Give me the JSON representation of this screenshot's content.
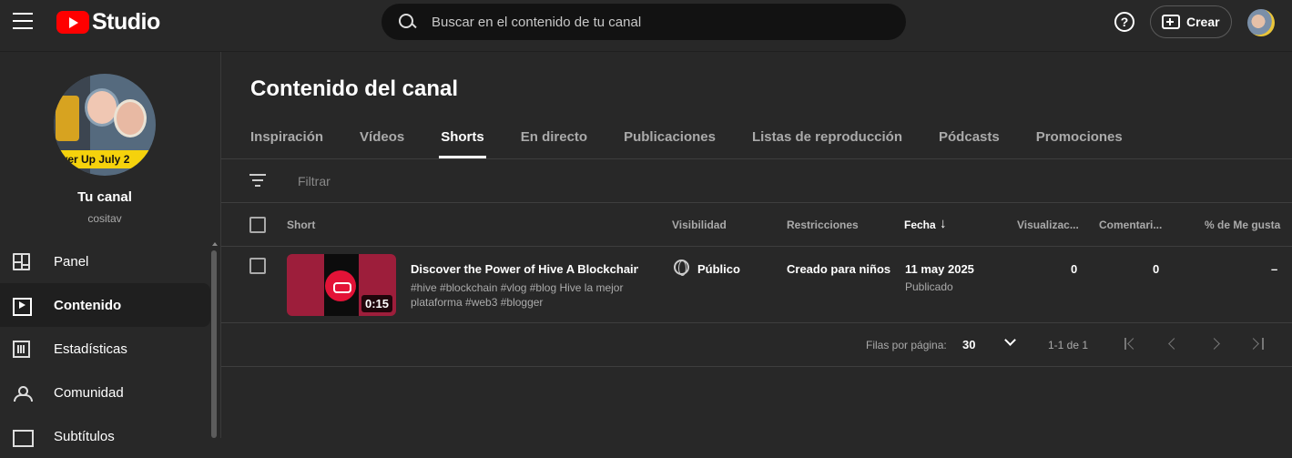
{
  "header": {
    "logo_text": "Studio",
    "search_placeholder": "Buscar en el contenido de tu canal",
    "help_label": "?",
    "create_label": "Crear"
  },
  "sidebar": {
    "avatar_banner_text": "wer Up July 2",
    "channel_label": "Tu canal",
    "handle": "cositav",
    "items": [
      {
        "label": "Panel",
        "icon": "dashboard-icon"
      },
      {
        "label": "Contenido",
        "icon": "content-icon"
      },
      {
        "label": "Estadísticas",
        "icon": "analytics-icon"
      },
      {
        "label": "Comunidad",
        "icon": "community-icon"
      },
      {
        "label": "Subtítulos",
        "icon": "subtitles-icon"
      }
    ]
  },
  "main": {
    "title": "Contenido del canal",
    "tabs": [
      "Inspiración",
      "Vídeos",
      "Shorts",
      "En directo",
      "Publicaciones",
      "Listas de reproducción",
      "Pódcasts",
      "Promociones"
    ],
    "active_tab": "Shorts",
    "filter_placeholder": "Filtrar",
    "columns": {
      "short": "Short",
      "visibility": "Visibilidad",
      "restrictions": "Restricciones",
      "date": "Fecha",
      "views": "Visualizac...",
      "comments": "Comentari...",
      "likes": "% de Me gusta"
    },
    "rows": [
      {
        "duration": "0:15",
        "title": "Discover the Power of Hive A Blockchain ...",
        "description": "#hive #blockchain #vlog #blog Hive la mejor plataforma #web3 #blogger",
        "visibility": "Público",
        "restrictions": "Creado para niños",
        "date": "11 may 2025",
        "status": "Publicado",
        "views": "0",
        "comments": "0",
        "likes": "–"
      }
    ],
    "pager": {
      "rows_label": "Filas por página:",
      "rows_value": "30",
      "range": "1-1 de 1"
    }
  }
}
